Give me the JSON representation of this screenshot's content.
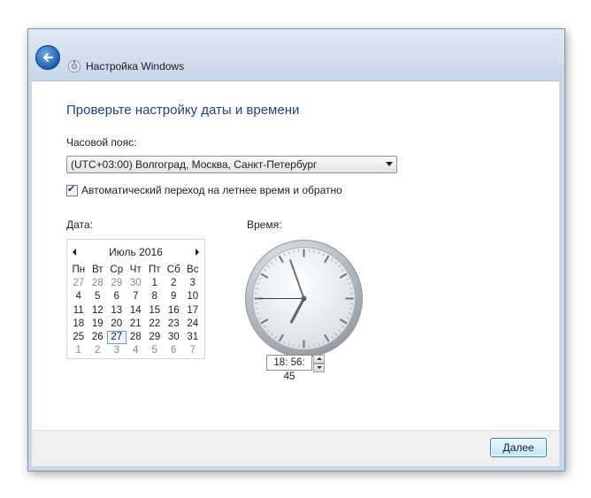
{
  "window": {
    "title": "Настройка Windows",
    "back_icon": "back-arrow-icon",
    "app_icon": "windows-setup-icon"
  },
  "main": {
    "heading": "Проверьте настройку даты и времени",
    "timezone_label": "Часовой пояс:",
    "timezone_value": "(UTC+03:00) Волгоград, Москва, Санкт-Петербург",
    "dst_checked": true,
    "dst_label": "Автоматический переход на летнее время и обратно",
    "date_label": "Дата:",
    "time_label": "Время:",
    "time_value": "18: 56: 45"
  },
  "calendar": {
    "month_title": "Июль 2016",
    "weekdays": [
      "Пн",
      "Вт",
      "Ср",
      "Чт",
      "Пт",
      "Сб",
      "Вс"
    ],
    "weeks": [
      [
        "27",
        "28",
        "29",
        "30",
        "1",
        "2",
        "3"
      ],
      [
        "4",
        "5",
        "6",
        "7",
        "8",
        "9",
        "10"
      ],
      [
        "11",
        "12",
        "13",
        "14",
        "15",
        "16",
        "17"
      ],
      [
        "18",
        "19",
        "20",
        "21",
        "22",
        "23",
        "24"
      ],
      [
        "25",
        "26",
        "27",
        "28",
        "29",
        "30",
        "31"
      ],
      [
        "1",
        "2",
        "3",
        "4",
        "5",
        "6",
        "7"
      ]
    ],
    "selected_day": "27"
  },
  "clock": {
    "hours": 18,
    "minutes": 56,
    "seconds": 45
  },
  "footer": {
    "next_label": "Далее"
  },
  "colors": {
    "heading": "#1e3f8a",
    "accent": "#1c5fb4",
    "other_month": "#8a8a8a"
  }
}
